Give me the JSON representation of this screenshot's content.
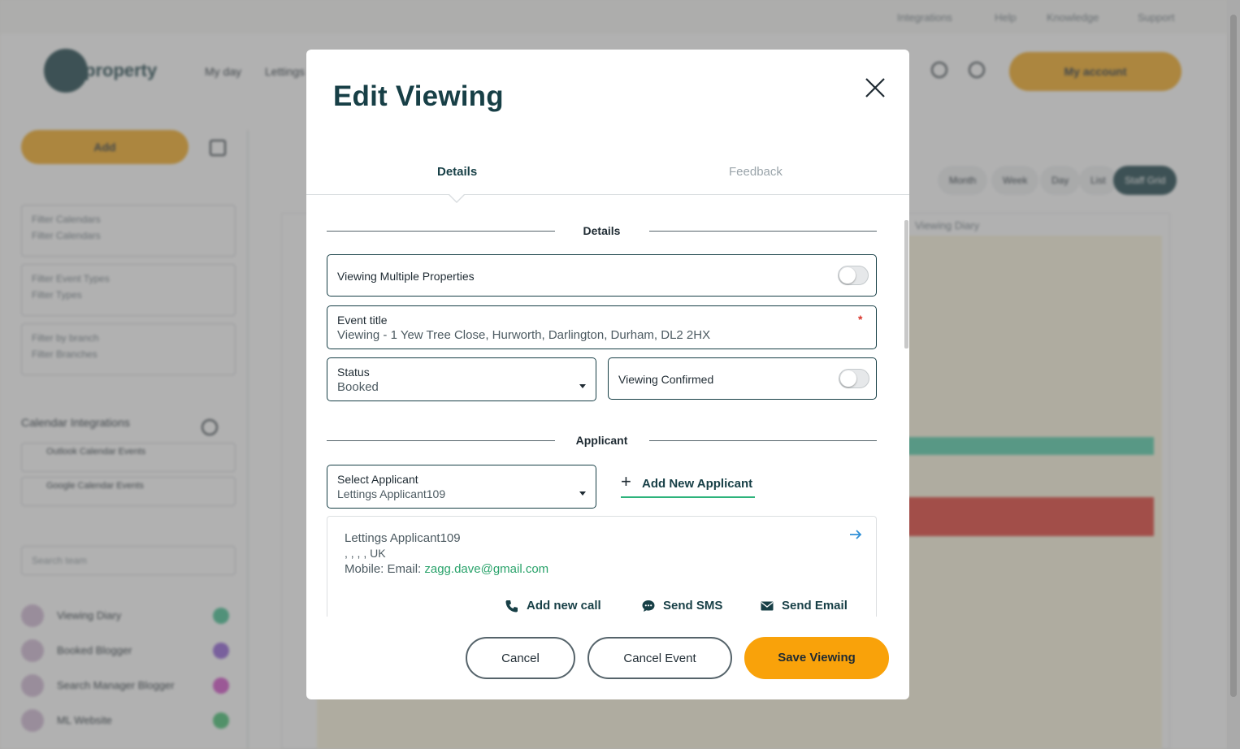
{
  "background": {
    "top_links": [
      "Integrations",
      "Help",
      "Knowledge",
      "Support"
    ],
    "logo_text": "property",
    "nav": [
      "My day",
      "Lettings"
    ],
    "account_label": "My account",
    "add_label": "Add",
    "filters": [
      {
        "label": "Filter Calendars",
        "value": "Filter Calendars"
      },
      {
        "label": "Filter Event Types",
        "value": "Filter Types"
      },
      {
        "label": "Filter by branch",
        "value": "Filter Branches"
      }
    ],
    "integrations_title": "Calendar Integrations",
    "integrations": [
      "Outlook Calendar Events",
      "Google Calendar Events"
    ],
    "search_placeholder": "Search team",
    "calendars": [
      {
        "label": "Viewing Diary",
        "color": "#3fbf8f"
      },
      {
        "label": "Booked Blogger",
        "color": "#8e5cd6"
      },
      {
        "label": "Search Manager Blogger",
        "color": "#d34cc8"
      },
      {
        "label": "ML Website",
        "color": "#3fbf6e"
      }
    ],
    "view_tabs": [
      "Month",
      "Week",
      "Day",
      "List",
      "Staff Grid"
    ],
    "calendar_header": "Viewing Diary",
    "colors": {
      "accent": "#f4a81a",
      "brand": "#173f46",
      "event_green": "#4dcda6",
      "event_red": "#e0392f"
    }
  },
  "modal": {
    "title": "Edit Viewing",
    "tabs": [
      {
        "label": "Details",
        "active": true
      },
      {
        "label": "Feedback",
        "active": false
      }
    ],
    "sections": {
      "details_heading": "Details",
      "applicant_heading": "Applicant"
    },
    "viewing_multiple": {
      "label": "Viewing Multiple Properties",
      "on": false
    },
    "event_title": {
      "label": "Event title",
      "required_mark": "*",
      "value": "Viewing - 1 Yew Tree Close, Hurworth, Darlington, Durham, DL2 2HX"
    },
    "status": {
      "label": "Status",
      "value": "Booked"
    },
    "viewing_confirmed": {
      "label": "Viewing Confirmed",
      "on": false
    },
    "select_applicant": {
      "label": "Select Applicant",
      "value": "Lettings Applicant109"
    },
    "add_new_applicant": {
      "plus": "+",
      "label": "Add New Applicant"
    },
    "applicant_card": {
      "name": "Lettings Applicant109",
      "address": ", , , , UK",
      "contact_prefix": "Mobile: Email: ",
      "email": "zagg.dave@gmail.com",
      "actions": [
        {
          "icon": "phone-icon",
          "label": "Add new call"
        },
        {
          "icon": "chat-icon",
          "label": "Send SMS"
        },
        {
          "icon": "envelope-icon",
          "label": "Send Email"
        }
      ]
    },
    "footer": {
      "cancel": "Cancel",
      "cancel_event": "Cancel Event",
      "save": "Save Viewing"
    },
    "colors": {
      "primary_button": "#f9a20a",
      "title": "#173f46",
      "link": "#2aa36b",
      "required": "#d9362c"
    }
  }
}
